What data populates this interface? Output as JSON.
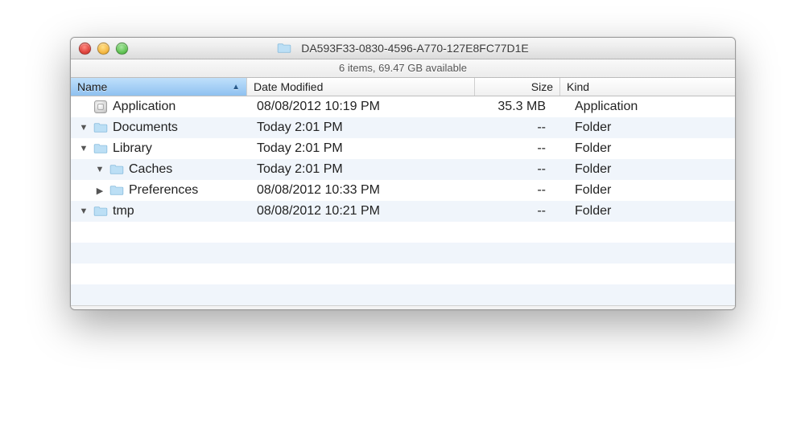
{
  "window": {
    "title": "DA593F33-0830-4596-A770-127E8FC77D1E"
  },
  "status": {
    "text": "6 items, 69.47 GB available"
  },
  "columns": {
    "name": "Name",
    "date": "Date Modified",
    "size": "Size",
    "kind": "Kind"
  },
  "rows": [
    {
      "indent": 0,
      "disclosure": "",
      "icon": "app",
      "name": "Application",
      "date": "08/08/2012 10:19 PM",
      "size": "35.3 MB",
      "kind": "Application"
    },
    {
      "indent": 0,
      "disclosure": "down",
      "icon": "folder",
      "name": "Documents",
      "date": "Today 2:01 PM",
      "size": "--",
      "kind": "Folder"
    },
    {
      "indent": 0,
      "disclosure": "down",
      "icon": "folder",
      "name": "Library",
      "date": "Today 2:01 PM",
      "size": "--",
      "kind": "Folder"
    },
    {
      "indent": 1,
      "disclosure": "down",
      "icon": "folder",
      "name": "Caches",
      "date": "Today 2:01 PM",
      "size": "--",
      "kind": "Folder"
    },
    {
      "indent": 1,
      "disclosure": "right",
      "icon": "folder",
      "name": "Preferences",
      "date": "08/08/2012 10:33 PM",
      "size": "--",
      "kind": "Folder"
    },
    {
      "indent": 0,
      "disclosure": "down",
      "icon": "folder",
      "name": "tmp",
      "date": "08/08/2012 10:21 PM",
      "size": "--",
      "kind": "Folder"
    }
  ]
}
